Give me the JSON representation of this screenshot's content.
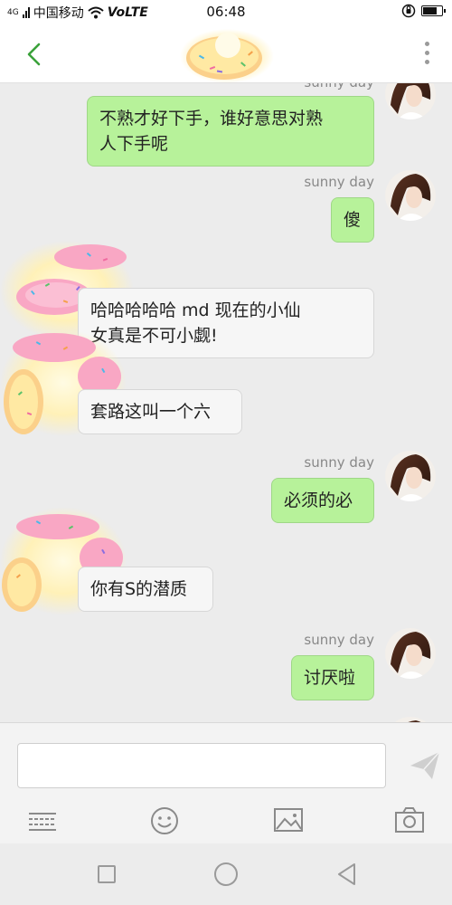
{
  "status_bar": {
    "signal": "4G",
    "carrier": "中国移动",
    "wifi_icon": "wifi-icon",
    "network": "VoLTE",
    "time": "06:48",
    "alarm_icon": "alarm-icon",
    "battery_level": 0.8
  },
  "header": {
    "back_icon": "back-arrow-icon",
    "more_icon": "more-vertical-icon"
  },
  "messages": [
    {
      "sender": "sunny day",
      "side": "me",
      "text_lines": [
        "不熟才好下手，谁好意思对熟",
        "人下手呢"
      ]
    },
    {
      "sender": "sunny day",
      "side": "me",
      "text_lines": [
        "傻"
      ]
    },
    {
      "sender": "",
      "side": "other",
      "text_lines": [
        "哈哈哈哈哈 md 现在的小仙",
        "女真是不可小觑!"
      ]
    },
    {
      "sender": "",
      "side": "other",
      "text_lines": [
        "套路这叫一个六"
      ]
    },
    {
      "sender": "sunny day",
      "side": "me",
      "text_lines": [
        "必须的必"
      ]
    },
    {
      "sender": "",
      "side": "other",
      "text_lines": [
        "你有S的潜质"
      ]
    },
    {
      "sender": "sunny day",
      "side": "me",
      "text_lines": [
        "讨厌啦"
      ]
    }
  ],
  "composer": {
    "input_value": "",
    "send_icon": "send-icon",
    "tools": [
      "keyboard-icon",
      "emoji-icon",
      "image-icon",
      "camera-icon"
    ]
  },
  "system_nav": {
    "buttons": [
      "recent-apps-icon",
      "home-icon",
      "back-icon"
    ]
  },
  "colors": {
    "my_bubble": "#b7f29a",
    "other_bubble": "#f6f6f6",
    "accent": "#3aa13a"
  }
}
